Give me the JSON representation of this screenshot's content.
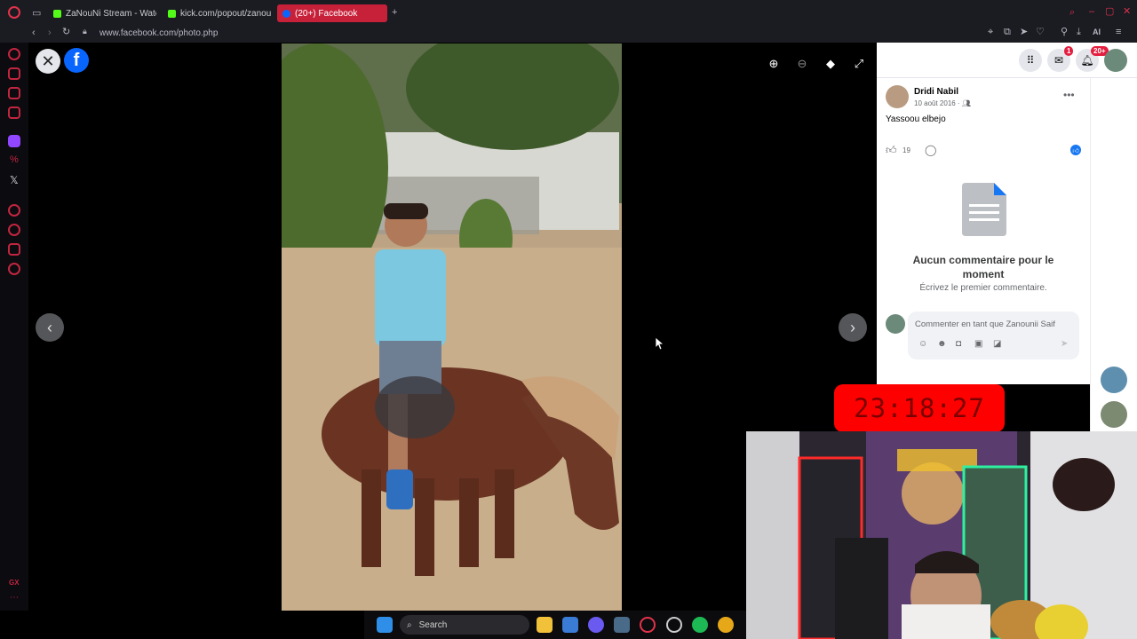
{
  "browser": {
    "tabs": [
      {
        "label": "ZaNouNi Stream - Watch L",
        "active": false
      },
      {
        "label": "kick.com/popout/zanouni/",
        "active": false
      },
      {
        "label": "(20+) Facebook",
        "active": true
      }
    ],
    "url": "www.facebook.com/photo.php",
    "toolbar_ai_label": "AI"
  },
  "sidebar": {
    "bottom_label": "GX"
  },
  "post": {
    "author": "Dridi Nabil",
    "date": "10 août 2016 · ",
    "caption": "Yassoou elbejo",
    "like_count": "19",
    "no_comments_title": "Aucun commentaire pour le moment",
    "no_comments_subtitle": "Écrivez le premier commentaire.",
    "comment_placeholder": "Commenter en tant que Zanounii Saif"
  },
  "fb_header": {
    "messenger_badge": "1",
    "notifications_badge": "20+"
  },
  "timer": "23:18:27",
  "taskbar": {
    "search_label": "Search"
  },
  "colors": {
    "accent_opera": "#c7213a",
    "facebook_blue": "#0866ff",
    "timer_red": "#ff0000"
  }
}
